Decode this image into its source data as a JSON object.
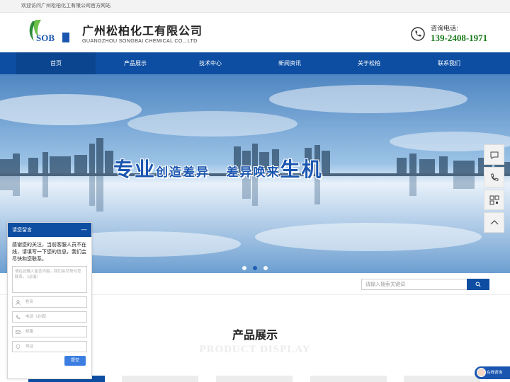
{
  "topbar": {
    "welcome": "欢迎访问广州松柏化工有限公司官方网站"
  },
  "header": {
    "logo_text": "SOB",
    "company_cn": "广州松柏化工有限公司",
    "company_en": "GUANGZHOU SONGBAI CHEMICAL CO., LTD",
    "phone_label": "咨询电话:",
    "phone_number": "139-2408-1971"
  },
  "nav": {
    "items": [
      "首页",
      "产品展示",
      "技术中心",
      "新闻资讯",
      "关于松柏",
      "联系我们"
    ]
  },
  "banner": {
    "title_1": "专业",
    "title_2": "创造差异",
    "title_3": "差异唤来",
    "title_4": "生机",
    "slides": 3,
    "active_slide": 2
  },
  "search": {
    "placeholder": "请输入搜索关键词"
  },
  "section": {
    "title": "产品展示",
    "subtitle": "PRODUCT DISPLAY"
  },
  "chat": {
    "header": "请您留言",
    "minimize": "—",
    "message": "感谢您的关注，当前客服人员不在线，请填写一下您的信息，我们会尽快和您联系。",
    "textarea_placeholder": "请在此输入留言内容，我们会尽快与您联系。（必填）",
    "name_placeholder": "姓名",
    "phone_placeholder": "电话（必填）",
    "email_placeholder": "邮箱",
    "address_placeholder": "地址",
    "submit": "提交"
  },
  "online": {
    "label": "在线咨询"
  },
  "colors": {
    "primary": "#0d4ea2",
    "phone": "#1a7a1a"
  }
}
